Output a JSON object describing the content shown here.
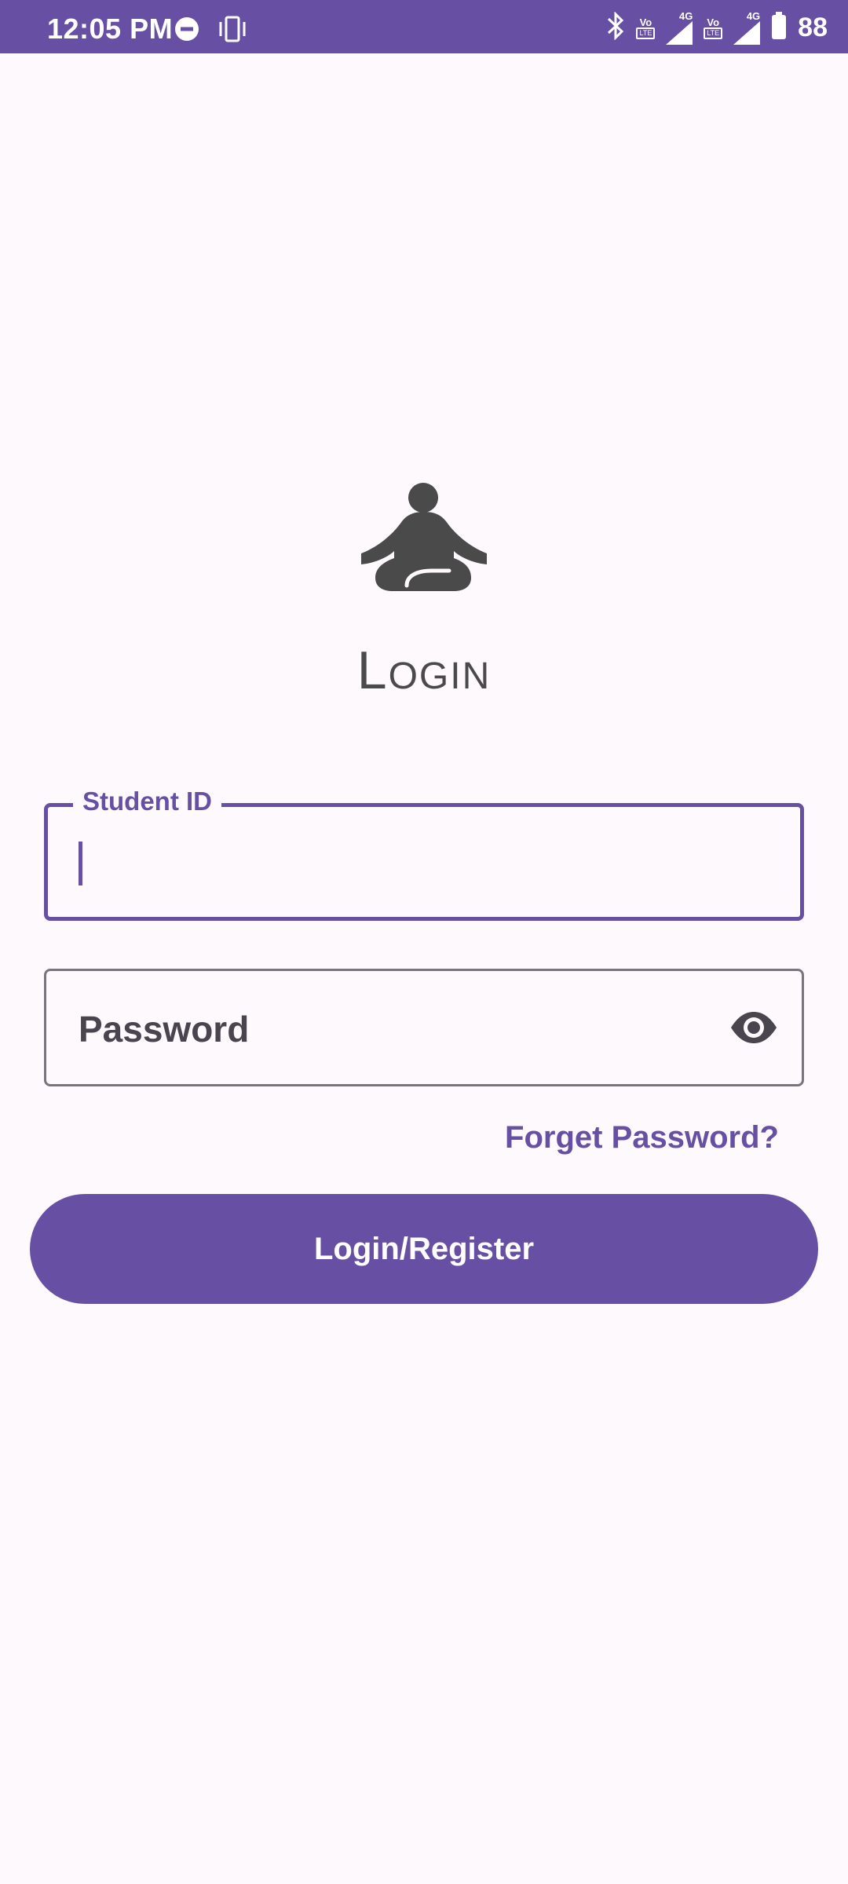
{
  "status_bar": {
    "time": "12:05 PM",
    "battery_level": "88",
    "icons": [
      "do-not-disturb-icon",
      "vibrate-icon",
      "bluetooth-icon",
      "volte-4g-icon",
      "signal-icon",
      "volte-4g-icon",
      "signal-icon",
      "battery-icon"
    ],
    "network_label": "4G",
    "volte_label": "Vo",
    "lte_label": "LTE"
  },
  "logo": {
    "icon": "meditation-icon",
    "color": "#4A4A4A"
  },
  "page": {
    "title": "Login"
  },
  "form": {
    "student_id": {
      "label": "Student ID",
      "value": ""
    },
    "password": {
      "placeholder": "Password",
      "toggle_icon": "eye-icon"
    },
    "forget_password_label": "Forget Password?",
    "submit_label": "Login/Register"
  },
  "colors": {
    "accent": "#6750A4",
    "background": "#FEF9FD",
    "text_dark": "#4A4A4A",
    "outline": "#79747E"
  }
}
